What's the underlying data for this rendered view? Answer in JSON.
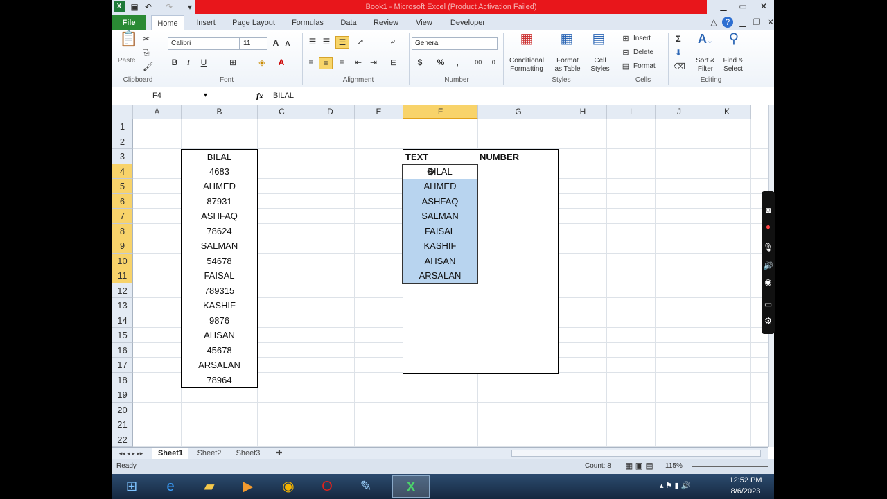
{
  "window": {
    "title": "Book1 - Microsoft Excel (Product Activation Failed)"
  },
  "tabs": [
    "File",
    "Home",
    "Insert",
    "Page Layout",
    "Formulas",
    "Data",
    "Review",
    "View",
    "Developer"
  ],
  "ribbon": {
    "clipboard": {
      "paste": "Paste",
      "label": "Clipboard"
    },
    "font": {
      "name": "Calibri",
      "size": "11",
      "label": "Font"
    },
    "alignment": {
      "label": "Alignment"
    },
    "number": {
      "format": "General",
      "label": "Number"
    },
    "styles": {
      "conditional": "Conditional\nFormatting",
      "format_table": "Format\nas Table",
      "cell_styles": "Cell\nStyles",
      "label": "Styles"
    },
    "cells": {
      "insert": "Insert",
      "delete": "Delete",
      "format": "Format",
      "label": "Cells"
    },
    "editing": {
      "sort": "Sort &\nFilter",
      "find": "Find &\nSelect",
      "label": "Editing"
    }
  },
  "formula_bar": {
    "name_box": "F4",
    "fx": "fx",
    "value": "BILAL"
  },
  "columns": [
    "A",
    "B",
    "C",
    "D",
    "E",
    "F",
    "G",
    "H",
    "I",
    "J",
    "K"
  ],
  "rows": [
    "1",
    "2",
    "3",
    "4",
    "5",
    "6",
    "7",
    "8",
    "9",
    "10",
    "11",
    "12",
    "13",
    "14",
    "15",
    "16",
    "17",
    "18",
    "19",
    "20",
    "21",
    "22"
  ],
  "col_b": [
    "BILAL",
    "4683",
    "AHMED",
    "87931",
    "ASHFAQ",
    "78624",
    "SALMAN",
    "54678",
    "FAISAL",
    "789315",
    "KASHIF",
    "9876",
    "AHSAN",
    "45678",
    "ARSALAN",
    "78964"
  ],
  "table_f": {
    "header_text": "TEXT",
    "header_number": "NUMBER",
    "values": [
      "BILAL",
      "AHMED",
      "ASHFAQ",
      "SALMAN",
      "FAISAL",
      "KASHIF",
      "AHSAN",
      "ARSALAN"
    ]
  },
  "sheets": [
    "Sheet1",
    "Sheet2",
    "Sheet3"
  ],
  "status": {
    "ready": "Ready",
    "count": "Count: 8",
    "zoom": "115%"
  },
  "clock": {
    "time": "12:52 PM",
    "date": "8/6/2023"
  }
}
